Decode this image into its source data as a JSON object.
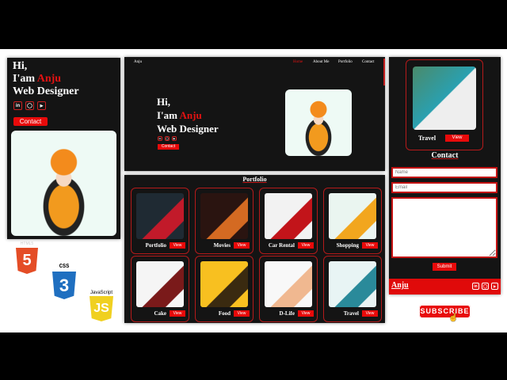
{
  "hero": {
    "hi": "Hi,",
    "iam": "I'am ",
    "name": "Anju",
    "role": "Web Designer",
    "contact": "Contact"
  },
  "social": {
    "linkedin": "in",
    "github": "◯",
    "youtube": "▶"
  },
  "nav": {
    "brand": "Anju",
    "items": [
      "Home",
      "About Me",
      "Portfolio",
      "Contact"
    ]
  },
  "portfolio": {
    "title": "Portfolio",
    "view": "View",
    "items": [
      {
        "label": "Portfolio",
        "c1": "#1f2a33",
        "c2": "#c21a2a"
      },
      {
        "label": "Movies",
        "c1": "#2a1410",
        "c2": "#d46a22"
      },
      {
        "label": "Car Rental",
        "c1": "#f2f2f2",
        "c2": "#c2141a"
      },
      {
        "label": "Shopping",
        "c1": "#eaf5f0",
        "c2": "#f2a61e"
      },
      {
        "label": "Cake",
        "c1": "#f5f5f5",
        "c2": "#7a1a1a"
      },
      {
        "label": "Food",
        "c1": "#f8c020",
        "c2": "#3a2a10"
      },
      {
        "label": "D-Life",
        "c1": "#f8f8f8",
        "c2": "#f0b890"
      },
      {
        "label": "Travel",
        "c1": "#e8f4f4",
        "c2": "#2a8a9a"
      }
    ]
  },
  "contact": {
    "title": "Contact",
    "name_placeholder": "Name",
    "email_placeholder": "Email",
    "submit": "Submit",
    "featured_label": "Travel",
    "view": "View",
    "footer_brand": "Anju"
  },
  "tech": {
    "html": "HTML5",
    "css": "CSS",
    "js": "JavaScript",
    "html_num": "5",
    "css_num": "3",
    "js_num": "JS"
  },
  "subscribe": "SUBSCRIBE"
}
